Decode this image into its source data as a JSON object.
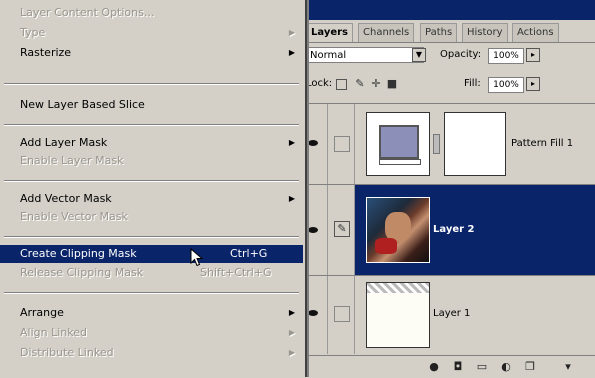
{
  "menu": {
    "items": [
      {
        "label": "Layer Content Options...",
        "disabled": true,
        "submenu": false
      },
      {
        "label": "Type",
        "disabled": true,
        "submenu": true
      },
      {
        "label": "Rasterize",
        "disabled": false,
        "submenu": true
      },
      {
        "label": "New Layer Based Slice",
        "disabled": false,
        "submenu": false
      },
      {
        "label": "Add Layer Mask",
        "disabled": false,
        "submenu": true
      },
      {
        "label": "Enable Layer Mask",
        "disabled": true,
        "submenu": false
      },
      {
        "label": "Add Vector Mask",
        "disabled": false,
        "submenu": true
      },
      {
        "label": "Enable Vector Mask",
        "disabled": true,
        "submenu": false
      },
      {
        "label": "Create Clipping Mask",
        "shortcut": "Ctrl+G",
        "highlighted": true
      },
      {
        "label": "Release Clipping Mask",
        "shortcut": "Shift+Ctrl+G",
        "disabled": true
      },
      {
        "label": "Arrange",
        "disabled": false,
        "submenu": true
      },
      {
        "label": "Align Linked",
        "disabled": true,
        "submenu": true
      },
      {
        "label": "Distribute Linked",
        "disabled": true,
        "submenu": true
      }
    ]
  },
  "palette": {
    "tabs": [
      "Layers",
      "Channels",
      "Paths",
      "History",
      "Actions"
    ],
    "active_tab": "Layers",
    "blend_mode": "Normal",
    "opacity_label": "Opacity:",
    "opacity_value": "100%",
    "lock_label": "Lock:",
    "fill_label": "Fill:",
    "fill_value": "100%",
    "layers": [
      {
        "name": "Pattern Fill 1",
        "selected": false
      },
      {
        "name": "Layer 2",
        "selected": true
      },
      {
        "name": "Layer 1",
        "selected": false
      }
    ]
  },
  "colors": {
    "highlight": "#0a246a",
    "menu_bg": "#d4d0c8"
  }
}
